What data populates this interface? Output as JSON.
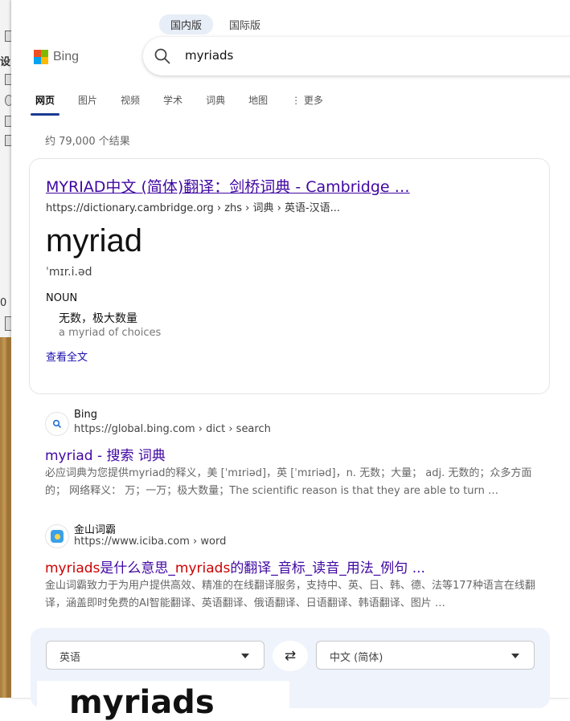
{
  "background_window": {
    "label_1": "设",
    "label_2": "0"
  },
  "header": {
    "market_tabs": [
      {
        "label": "国内版"
      },
      {
        "label": "国际版"
      }
    ],
    "brand": "Bing",
    "brand_colors": [
      "#f25022",
      "#7fba00",
      "#00a4ef",
      "#ffb900"
    ],
    "search": {
      "query": "myriads"
    }
  },
  "tabs": [
    {
      "label": "网页"
    },
    {
      "label": "图片"
    },
    {
      "label": "视频"
    },
    {
      "label": "学术"
    },
    {
      "label": "词典"
    },
    {
      "label": "地图"
    },
    {
      "label": "更多"
    }
  ],
  "results_count": "约 79,000 个结果",
  "dict_card": {
    "title": "MYRIAD中文 (简体)翻译：剑桥词典 - Cambridge …",
    "url": "https://dictionary.cambridge.org › zhs › 词典 › 英语-汉语...",
    "word": "myriad",
    "pronunciation": "ˈmɪr.i.əd",
    "pos": "NOUN",
    "definition": "无数，极大数量",
    "example": "a myriad of choices",
    "more_link": "查看全文"
  },
  "results": [
    {
      "site": "Bing",
      "url": "https://global.bing.com › dict › search",
      "title": "myriad - 搜索 词典",
      "snippet": "必应词典为您提供myriad的释义，美 [ˈmɪriəd]，英 [ˈmɪriəd]，n. 无数；大量； adj. 无数的；众多方面的； 网络释义： 万；一万；极大数量；The scientific reason is that they are able to turn …"
    },
    {
      "site": "金山词霸",
      "url": "https://www.iciba.com › word",
      "title_hl": "myriads",
      "title_rest_1": "是什么意思_",
      "title_hl_2": "myriads",
      "title_rest_2": "的翻译_音标_读音_用法_例句 ...",
      "snippet": "金山词霸致力于为用户提供高效、精准的在线翻译服务，支持中、英、日、韩、德、法等177种语言在线翻译，涵盖即时免费的AI智能翻译、英语翻译、俄语翻译、日语翻译、韩语翻译、图片 …"
    }
  ],
  "translator": {
    "source_lang": "英语",
    "target_lang": "中文 (简体)",
    "source_text": "myriads"
  }
}
